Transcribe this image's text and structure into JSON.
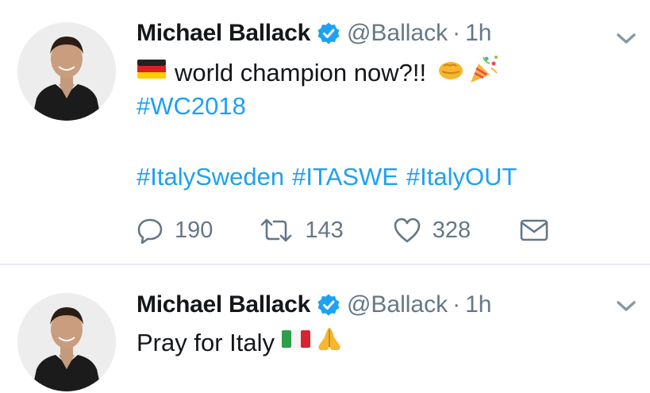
{
  "tweets": [
    {
      "author": "Michael Ballack",
      "handle": "@Ballack",
      "separator": "·",
      "time": "1h",
      "line1_text": "world champion now?!!",
      "line2_hashtag": "#WC2018",
      "hashtags": [
        "#ItalySweden",
        "#ITASWE",
        "#ItalyOUT"
      ],
      "replies": "190",
      "retweets": "143",
      "likes": "328"
    },
    {
      "author": "Michael Ballack",
      "handle": "@Ballack",
      "separator": "·",
      "time": "1h",
      "line1_text": "Pray for Italy"
    }
  ],
  "icons": {
    "verified": "verified-badge-icon",
    "chevron": "chevron-down-icon",
    "reply": "reply-icon",
    "retweet": "retweet-icon",
    "like": "heart-icon",
    "dm": "envelope-icon",
    "flag_germany": "germany-flag-emoji",
    "fist": "oncoming-fist-emoji",
    "party": "party-popper-emoji",
    "flag_italy": "italy-flag-emoji",
    "pray": "folded-hands-emoji"
  },
  "colors": {
    "link": "#1da1f2",
    "muted": "#657786",
    "text": "#14171a",
    "divider": "#e6ecf0"
  }
}
